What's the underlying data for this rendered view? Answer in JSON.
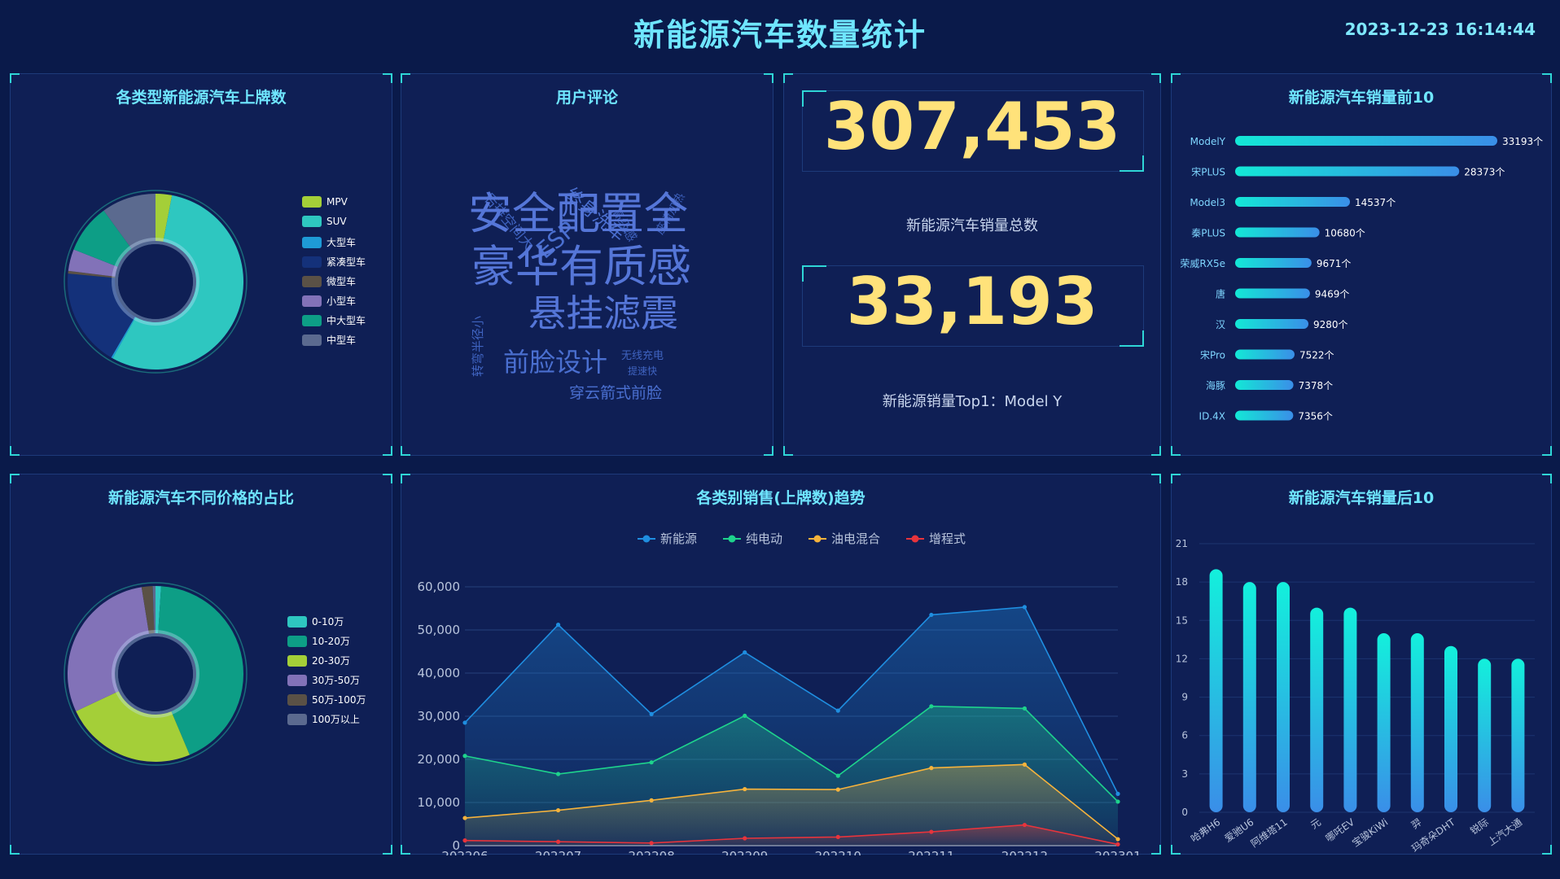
{
  "header": {
    "title": "新能源汽车数量统计",
    "datetime": "2023-12-23 16:14:44"
  },
  "colors": {
    "background": "#0a1a4a",
    "panel": "#0f1f55",
    "accent": "#6fe6ff",
    "number": "#ffe27a"
  },
  "panel_type_pie": {
    "title": "各类型新能源汽车上牌数",
    "chart_data": {
      "type": "pie",
      "slices": [
        {
          "name": "MPV",
          "value": 3,
          "color": "#a4cf38"
        },
        {
          "name": "SUV",
          "value": 55,
          "color": "#2ec7c0"
        },
        {
          "name": "大型车",
          "value": 0.3,
          "color": "#1e9ad6"
        },
        {
          "name": "紧凑型车",
          "value": 18,
          "color": "#14317a"
        },
        {
          "name": "微型车",
          "value": 0.5,
          "color": "#5a5146"
        },
        {
          "name": "小型车",
          "value": 4,
          "color": "#8272b8"
        },
        {
          "name": "中大型车",
          "value": 9,
          "color": "#0d9e86"
        },
        {
          "name": "中型车",
          "value": 10,
          "color": "#5b6a8f"
        }
      ]
    }
  },
  "panel_comments": {
    "title": "用户评论",
    "words": [
      "后排空间大",
      "终身洗车",
      "ESP",
      "高级感",
      "座椅加热",
      "安全配置全",
      "豪华有质感",
      "悬挂滤震",
      "转弯半径小",
      "前脸设计",
      "无线充电",
      "提速快",
      "穿云箭式前脸"
    ]
  },
  "panel_totals": {
    "total_value": "307,453",
    "total_label": "新能源汽车销量总数",
    "top_value": "33,193",
    "top_label": "新能源销量Top1：Model Y"
  },
  "panel_top10": {
    "title": "新能源汽车销量前10",
    "chart_data": {
      "type": "bar",
      "categories": [
        "ModelY",
        "宋PLUS",
        "Model3",
        "秦PLUS",
        "荣威RX5e",
        "唐",
        "汉",
        "宋Pro",
        "海豚",
        "ID.4X"
      ],
      "values": [
        33193,
        28373,
        14537,
        10680,
        9671,
        9469,
        9280,
        7522,
        7378,
        7356
      ],
      "value_labels": [
        "33193个",
        "28373个",
        "14537个",
        "10680个",
        "9671个",
        "9469个",
        "9280个",
        "7522个",
        "7378个",
        "7356个"
      ]
    }
  },
  "panel_price_pie": {
    "title": "新能源汽车不同价格的占比",
    "chart_data": {
      "type": "pie",
      "slices": [
        {
          "name": "0-10万",
          "value": 1,
          "color": "#2ec7c0"
        },
        {
          "name": "10-20万",
          "value": 42,
          "color": "#0d9e86"
        },
        {
          "name": "20-30万",
          "value": 24,
          "color": "#a4cf38"
        },
        {
          "name": "30万-50万",
          "value": 29,
          "color": "#8272b8"
        },
        {
          "name": "50万-100万",
          "value": 2,
          "color": "#5a5146"
        },
        {
          "name": "100万以上",
          "value": 0.5,
          "color": "#5b6a8f"
        }
      ]
    }
  },
  "panel_trend": {
    "title": "各类别销售(上牌数)趋势",
    "chart_data": {
      "type": "area",
      "x": [
        "202206",
        "202207",
        "202208",
        "202209",
        "202210",
        "202211",
        "202212",
        "202301"
      ],
      "ylim": [
        0,
        60000
      ],
      "yticks": [
        "0",
        "10,000",
        "20,000",
        "30,000",
        "40,000",
        "50,000",
        "60,000"
      ],
      "series": [
        {
          "name": "新能源",
          "color": "#1f8ee0",
          "values": [
            28500,
            51200,
            30500,
            44800,
            31300,
            53500,
            55300,
            12000
          ]
        },
        {
          "name": "纯电动",
          "color": "#1ed38c",
          "values": [
            20800,
            16600,
            19300,
            30100,
            16200,
            32300,
            31800,
            10200
          ]
        },
        {
          "name": "油电混合",
          "color": "#f6b33c",
          "values": [
            6400,
            8200,
            10500,
            13100,
            13000,
            18000,
            18800,
            1500
          ]
        },
        {
          "name": "增程式",
          "color": "#e8343c",
          "values": [
            1200,
            900,
            600,
            1700,
            2000,
            3200,
            4800,
            300
          ]
        }
      ]
    }
  },
  "panel_bottom10": {
    "title": "新能源汽车销量后10",
    "chart_data": {
      "type": "bar",
      "categories": [
        "哈弗H6",
        "爱驰U6",
        "阿维塔11",
        "元",
        "哪吒EV",
        "宝骏KiWi",
        "羿",
        "玛奇朵DHT",
        "锐际",
        "上汽大通"
      ],
      "values": [
        19,
        18,
        18,
        16,
        16,
        14,
        14,
        13,
        12,
        12
      ],
      "ylim": [
        0,
        21
      ],
      "yticks": [
        "0",
        "3",
        "6",
        "9",
        "12",
        "15",
        "18",
        "21"
      ]
    }
  }
}
